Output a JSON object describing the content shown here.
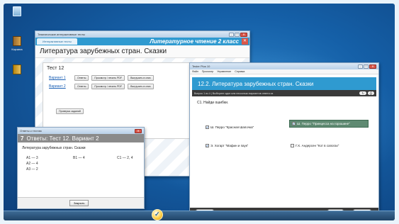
{
  "desktop": {
    "icons": [
      {
        "label": "",
        "icon": "computer-icon"
      },
      {
        "label": "Корзина",
        "icon": "book-icon"
      },
      {
        "label": "",
        "icon": "book-icon"
      }
    ]
  },
  "test_window": {
    "title": "Тематические интерактивные тесты",
    "tab": "Интерактивные тесты",
    "subject": "Литературное чтение  2 класс",
    "heading": "Литература зарубежных стран. Сказки",
    "panel_title": "Тест 12",
    "variants": [
      {
        "label": "Вариант 1",
        "buttons": [
          "Ответы",
          "Просмотр / печать PDF",
          "Выгрузить в спис"
        ]
      },
      {
        "label": "Вариант 2",
        "buttons": [
          "Ответы",
          "Просмотр / печать PDF",
          "Выгрузить в спис"
        ]
      }
    ],
    "check_button": "Проверка заданий"
  },
  "answers_window": {
    "title": "Ответы к тестам",
    "number": "7",
    "header": "Ответы: Тест 12. Вариант 2",
    "subtitle": "Литература зарубежных стран. Сказки",
    "col1": [
      "А1 — 3",
      "А2 — 4",
      "А3 — 2"
    ],
    "col2": [
      "В1 — 4"
    ],
    "col3": [
      "С1 — 2, 4"
    ],
    "close_button": "Закрыть"
  },
  "tester_window": {
    "title": "Tester Plus 10",
    "menu": [
      "Файл",
      "Просмотр",
      "Управление",
      "Справка"
    ],
    "question_title": "12.2. Литература зарубежных стран. Сказки",
    "bar_text": "Вопрос 1 из 4 | Выберите один или несколько вариантов ответа из",
    "task": "С1. Найди ошибки.",
    "options": [
      {
        "text": "Ш. Перро \"Красная Шапочка\"",
        "checked": true,
        "selected": false
      },
      {
        "text": "Ш. Перро \"Принцесса на горошине\"",
        "checked": true,
        "selected": true
      },
      {
        "text": "Э. Хогарт \"Мафин и паук\"",
        "checked": true,
        "selected": false
      },
      {
        "text": "Г.Х. Андерсен \"Кот в сапогах\"",
        "checked": false,
        "selected": false
      }
    ],
    "about_button": "Об ан...",
    "prev_button": "Назад",
    "next_button": "Вперед"
  },
  "colors": {
    "accent": "#2f9ad0",
    "selected_option": "#5f8a72",
    "close": "#d9574a"
  }
}
